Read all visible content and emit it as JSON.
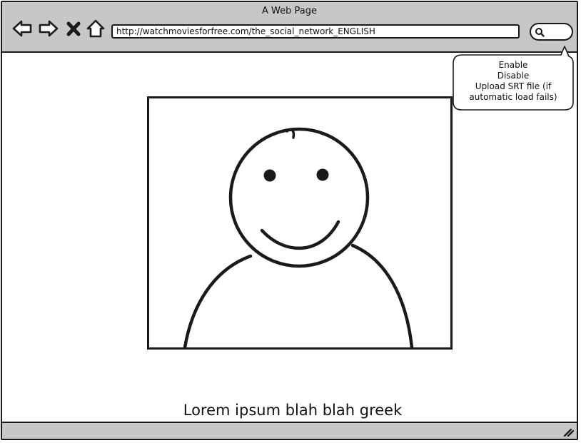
{
  "window": {
    "title": "A Web Page"
  },
  "toolbar": {
    "back_icon": "arrow-left-icon",
    "forward_icon": "arrow-right-icon",
    "stop_icon": "close-icon",
    "home_icon": "home-icon",
    "search_icon": "search-icon"
  },
  "address_bar": {
    "url": "http://watchmoviesforfree.com/the_social_network_ENGLISH"
  },
  "subtitle_menu": {
    "items": [
      {
        "label": "Enable"
      },
      {
        "label": "Disable"
      },
      {
        "label": "Upload SRT file (if automatic load fails)"
      }
    ]
  },
  "video": {
    "placeholder_icon": "person-placeholder-icon"
  },
  "subtitle_line": "Lorem ipsum blah blah greek",
  "colors": {
    "chrome": "#c7c7c7",
    "stroke": "#1a1a1a",
    "background": "#ffffff"
  }
}
